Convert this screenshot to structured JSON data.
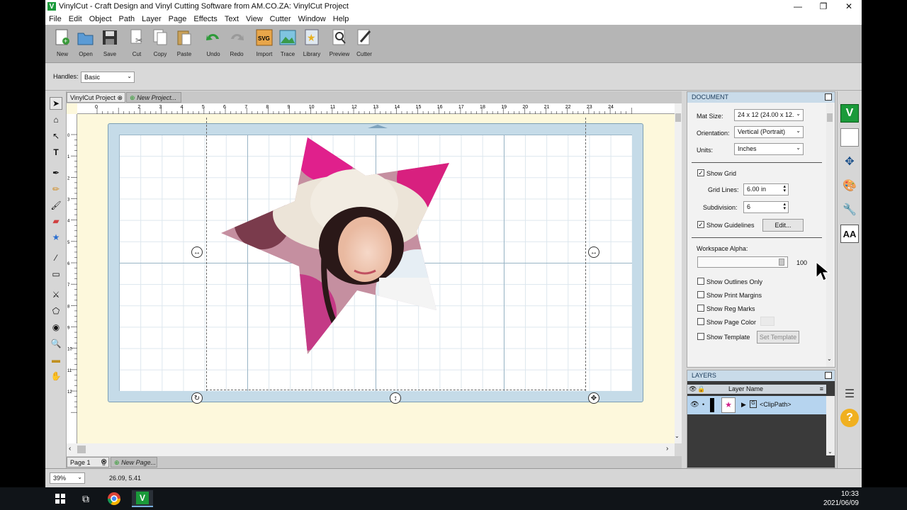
{
  "window": {
    "title": "VinylCut - Craft Design and Vinyl Cutting Software from AM.CO.ZA: VinylCut Project"
  },
  "menu": [
    "File",
    "Edit",
    "Object",
    "Path",
    "Layer",
    "Page",
    "Effects",
    "Text",
    "View",
    "Cutter",
    "Window",
    "Help"
  ],
  "toolbar": {
    "new": "New",
    "open": "Open",
    "save": "Save",
    "cut": "Cut",
    "copy": "Copy",
    "paste": "Paste",
    "undo": "Undo",
    "redo": "Redo",
    "import": "Import",
    "trace": "Trace",
    "library": "Library",
    "preview": "Preview",
    "cutter": "Cutter"
  },
  "handles": {
    "label": "Handles:",
    "value": "Basic"
  },
  "doc_tabs": {
    "active": "VinylCut Project",
    "new": "New Project..."
  },
  "ruler": {
    "h": [
      "0",
      "2",
      "3",
      "4",
      "5",
      "6",
      "7",
      "8",
      "9",
      "10",
      "11",
      "12",
      "13",
      "14",
      "15",
      "16",
      "17",
      "18",
      "19",
      "20",
      "21",
      "22",
      "23",
      "24"
    ],
    "v": [
      "0",
      "1",
      "2",
      "3",
      "4",
      "5",
      "6",
      "7",
      "8",
      "9",
      "10",
      "11",
      "12"
    ]
  },
  "page_tabs": {
    "active": "Page 1",
    "new": "New Page..."
  },
  "status": {
    "zoom": "39%",
    "coords": "26.09, 5.41"
  },
  "document": {
    "header": "DOCUMENT",
    "mat_size_label": "Mat Size:",
    "mat_size": "24 x 12 (24.00 x 12.",
    "orientation_label": "Orientation:",
    "orientation": "Vertical (Portrait)",
    "units_label": "Units:",
    "units": "Inches",
    "show_grid": "Show Grid",
    "grid_lines_label": "Grid Lines:",
    "grid_lines": "6.00 in",
    "subdivision_label": "Subdivision:",
    "subdivision": "6",
    "show_guidelines": "Show Guidelines",
    "edit": "Edit...",
    "alpha_label": "Workspace Alpha:",
    "alpha_value": "100",
    "show_outlines": "Show Outlines Only",
    "show_print_margins": "Show Print Margins",
    "show_reg_marks": "Show Reg Marks",
    "show_page_color": "Show Page Color",
    "show_template": "Show Template",
    "set_template": "Set Template"
  },
  "layers": {
    "header": "LAYERS",
    "col_name": "Layer Name",
    "row_name": "<ClipPath>"
  },
  "taskbar": {
    "time": "10:33",
    "date": "2021/06/09"
  }
}
